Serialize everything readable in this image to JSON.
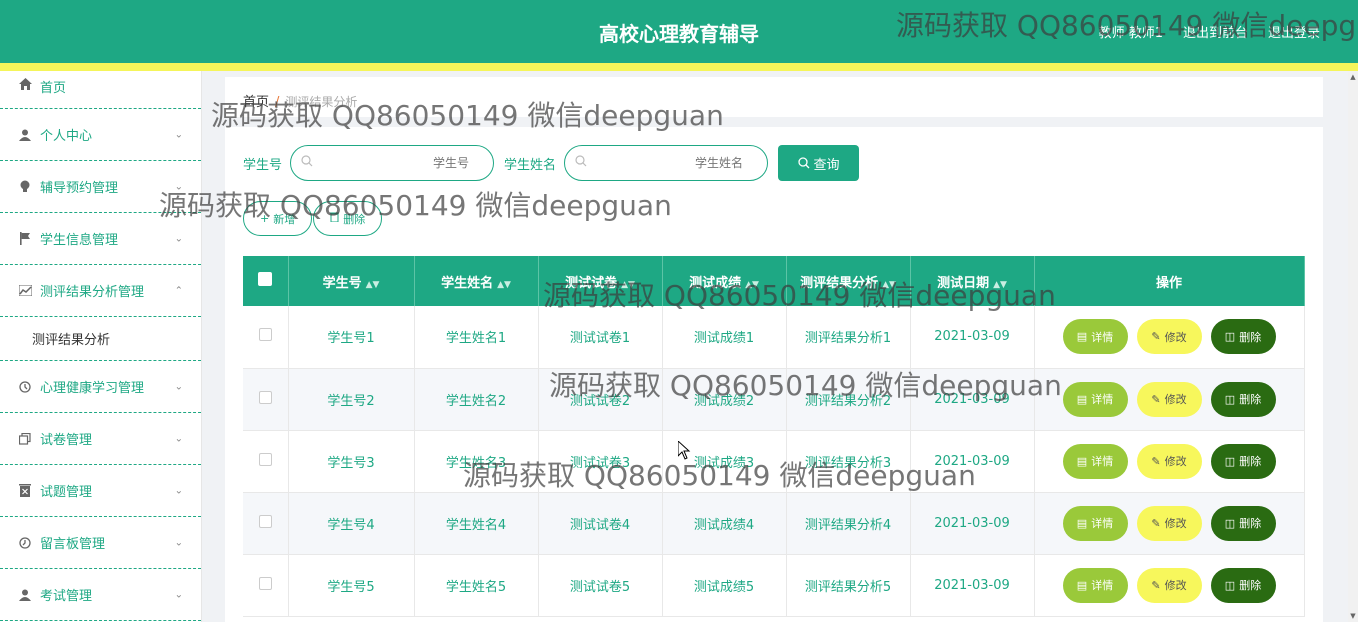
{
  "header": {
    "title": "高校心理教育辅导",
    "user": "教师 教师1",
    "to_front": "退出到前台",
    "logout": "退出登录"
  },
  "sidebar": {
    "items": [
      {
        "label": "首页",
        "icon": "home-icon"
      },
      {
        "label": "个人中心",
        "icon": "user-icon"
      },
      {
        "label": "辅导预约管理",
        "icon": "bulb-icon"
      },
      {
        "label": "学生信息管理",
        "icon": "flag-icon"
      },
      {
        "label": "测评结果分析管理",
        "icon": "chart-icon"
      },
      {
        "label": "心理健康学习管理",
        "icon": "clock-icon"
      },
      {
        "label": "试卷管理",
        "icon": "copy-icon"
      },
      {
        "label": "试题管理",
        "icon": "delete-box-icon"
      },
      {
        "label": "留言板管理",
        "icon": "clock-icon"
      },
      {
        "label": "考试管理",
        "icon": "user-icon"
      }
    ],
    "submenu": "测评结果分析"
  },
  "breadcrumb": {
    "home": "首页",
    "sep": "/",
    "current": "测评结果分析"
  },
  "search": {
    "student_no_label": "学生号",
    "student_no_placeholder": "学生号",
    "student_name_label": "学生姓名",
    "student_name_placeholder": "学生姓名",
    "query_label": "查询"
  },
  "actions": {
    "add_label": "新增",
    "delete_label": "删除"
  },
  "table": {
    "headers": [
      "学生号",
      "学生姓名",
      "测试试卷",
      "测试成绩",
      "测评结果分析",
      "测试日期",
      "操作"
    ],
    "rows": [
      [
        "学生号1",
        "学生姓名1",
        "测试试卷1",
        "测试成绩1",
        "测评结果分析1",
        "2021-03-09"
      ],
      [
        "学生号2",
        "学生姓名2",
        "测试试卷2",
        "测试成绩2",
        "测评结果分析2",
        "2021-03-09"
      ],
      [
        "学生号3",
        "学生姓名3",
        "测试试卷3",
        "测试成绩3",
        "测评结果分析3",
        "2021-03-09"
      ],
      [
        "学生号4",
        "学生姓名4",
        "测试试卷4",
        "测试成绩4",
        "测评结果分析4",
        "2021-03-09"
      ],
      [
        "学生号5",
        "学生姓名5",
        "测试试卷5",
        "测试成绩5",
        "测评结果分析5",
        "2021-03-09"
      ]
    ],
    "row_actions": {
      "detail": "详情",
      "edit": "修改",
      "delete": "删除"
    }
  },
  "watermark": "源码获取 QQ86050149 微信deepguan",
  "colors": {
    "primary": "#1ea884",
    "accent_bar": "#f5f55a",
    "detail": "#9ac93a",
    "edit": "#f7f75c",
    "delete": "#2a6b12"
  }
}
